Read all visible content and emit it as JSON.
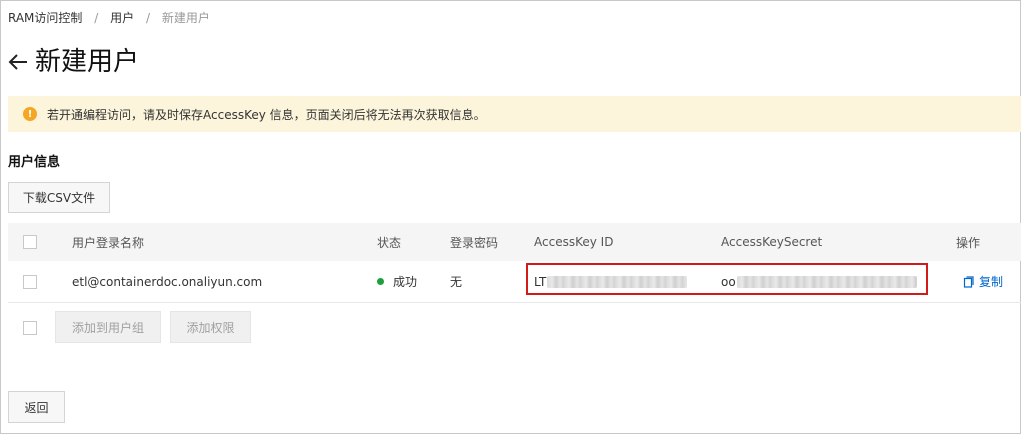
{
  "breadcrumb": {
    "items": [
      "RAM访问控制",
      "用户",
      "新建用户"
    ],
    "separator": "/"
  },
  "page": {
    "title": "新建用户",
    "back_icon": "arrow-left-icon"
  },
  "notice": {
    "icon": "warning-icon",
    "icon_glyph": "!",
    "text": "若开通编程访问，请及时保存AccessKey 信息，页面关闭后将无法再次获取信息。"
  },
  "section": {
    "title": "用户信息"
  },
  "buttons": {
    "download_csv": "下载CSV文件",
    "add_to_group": "添加到用户组",
    "add_permission": "添加权限",
    "back": "返回"
  },
  "table": {
    "columns": [
      "用户登录名称",
      "状态",
      "登录密码",
      "AccessKey ID",
      "AccessKeySecret",
      "操作"
    ],
    "rows": [
      {
        "login_name": "etl@containerdoc.onaliyun.com",
        "status": "成功",
        "password": "无",
        "access_key_id": "LT",
        "access_key_secret": "oo",
        "action": "复制"
      }
    ]
  },
  "colors": {
    "notice_bg": "#fcf5dc",
    "warning": "#f5a623",
    "success": "#1e9e3c",
    "link": "#0066cc",
    "highlight_border": "#d11a1a"
  }
}
